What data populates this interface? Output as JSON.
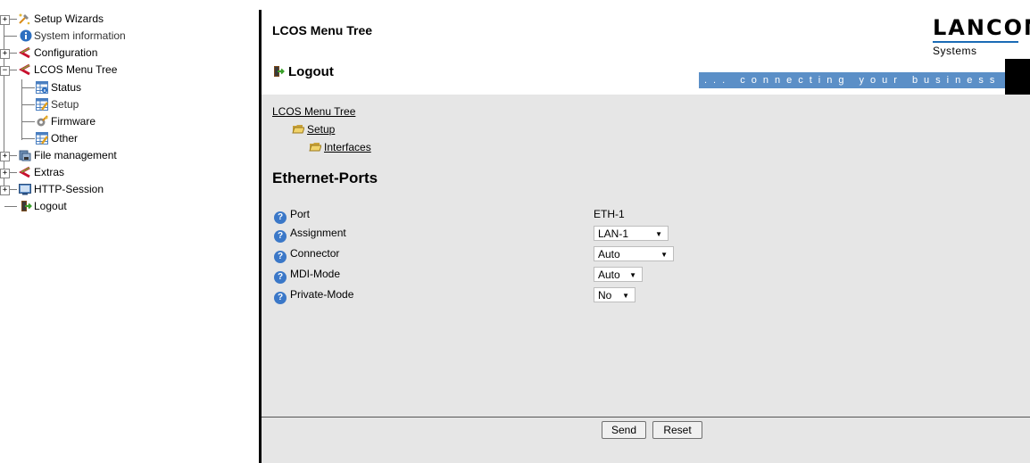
{
  "tree": {
    "items": [
      {
        "label": "Setup Wizards",
        "icon": "setup-wizards-icon"
      },
      {
        "label": "System information",
        "icon": "info-icon"
      },
      {
        "label": "Configuration",
        "icon": "configuration-icon"
      },
      {
        "label": "LCOS Menu Tree",
        "icon": "lcos-menu-tree-icon"
      },
      {
        "label": "Status",
        "icon": "status-table-icon"
      },
      {
        "label": "Setup",
        "icon": "setup-table-icon"
      },
      {
        "label": "Firmware",
        "icon": "firmware-icon"
      },
      {
        "label": "Other",
        "icon": "other-table-icon"
      },
      {
        "label": "File management",
        "icon": "file-management-icon"
      },
      {
        "label": "Extras",
        "icon": "extras-icon"
      },
      {
        "label": "HTTP-Session",
        "icon": "http-session-icon"
      },
      {
        "label": "Logout",
        "icon": "logout-icon"
      }
    ],
    "expander_collapsed": "+",
    "expander_expanded": "−"
  },
  "header": {
    "title": "LCOS Menu Tree",
    "logout": "Logout",
    "logo_word": "LANCOM",
    "logo_sub": "Systems",
    "slogan": "... connecting your business",
    "brand_color": "#5b8fc7"
  },
  "breadcrumb": {
    "root": "LCOS Menu Tree",
    "level1": "Setup",
    "level2": "Interfaces"
  },
  "section_title": "Ethernet-Ports",
  "form": {
    "port_label": "Port",
    "port_value": "ETH-1",
    "assignment_label": "Assignment",
    "assignment_value": "LAN-1",
    "connector_label": "Connector",
    "connector_value": "Auto",
    "mdi_label": "MDI-Mode",
    "mdi_value": "Auto",
    "private_label": "Private-Mode",
    "private_value": "No"
  },
  "buttons": {
    "send": "Send",
    "reset": "Reset"
  }
}
